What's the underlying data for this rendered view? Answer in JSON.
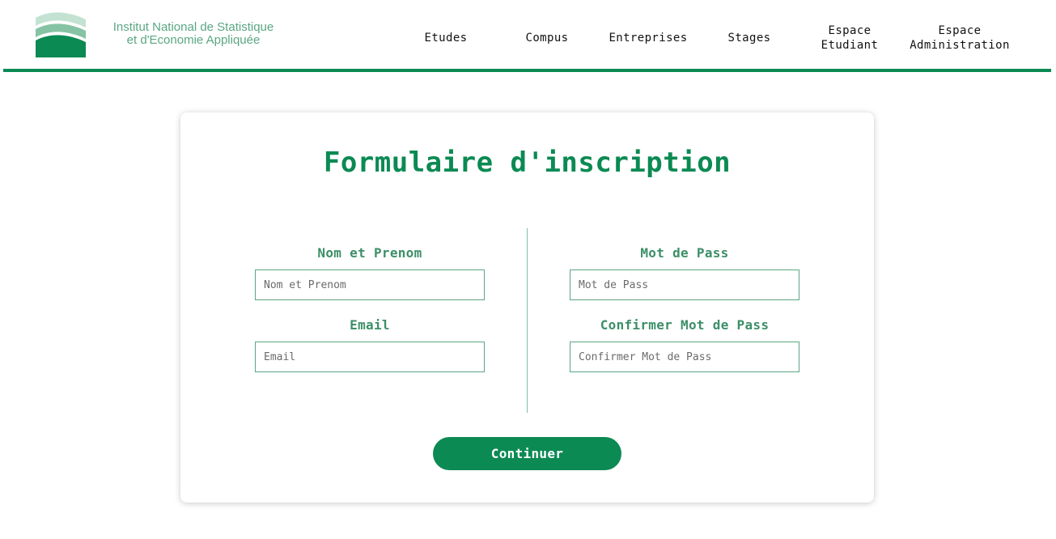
{
  "header": {
    "logo_line1": "Institut National de Statistique",
    "logo_line2": "et d'Economie Appliquée",
    "nav": [
      {
        "line1": "Etudes",
        "line2": ""
      },
      {
        "line1": "Compus",
        "line2": ""
      },
      {
        "line1": "Entreprises",
        "line2": ""
      },
      {
        "line1": "Stages",
        "line2": ""
      },
      {
        "line1": "Espace",
        "line2": "Etudiant"
      },
      {
        "line1": "Espace",
        "line2": "Administration"
      }
    ]
  },
  "form": {
    "title": "Formulaire d'inscription",
    "fields": [
      {
        "label": "Nom et Prenom",
        "placeholder": "Nom et Prenom",
        "value": ""
      },
      {
        "label": "Email",
        "placeholder": "Email",
        "value": ""
      },
      {
        "label": "Mot de Pass",
        "placeholder": "Mot de Pass",
        "value": ""
      },
      {
        "label": "Confirmer Mot de Pass",
        "placeholder": "Confirmer Mot de Pass",
        "value": ""
      }
    ],
    "submit_label": "Continuer"
  },
  "colors": {
    "brand_green": "#0b8a53",
    "label_green": "#3c8f68",
    "logo_light_green": "#a9d3be"
  }
}
